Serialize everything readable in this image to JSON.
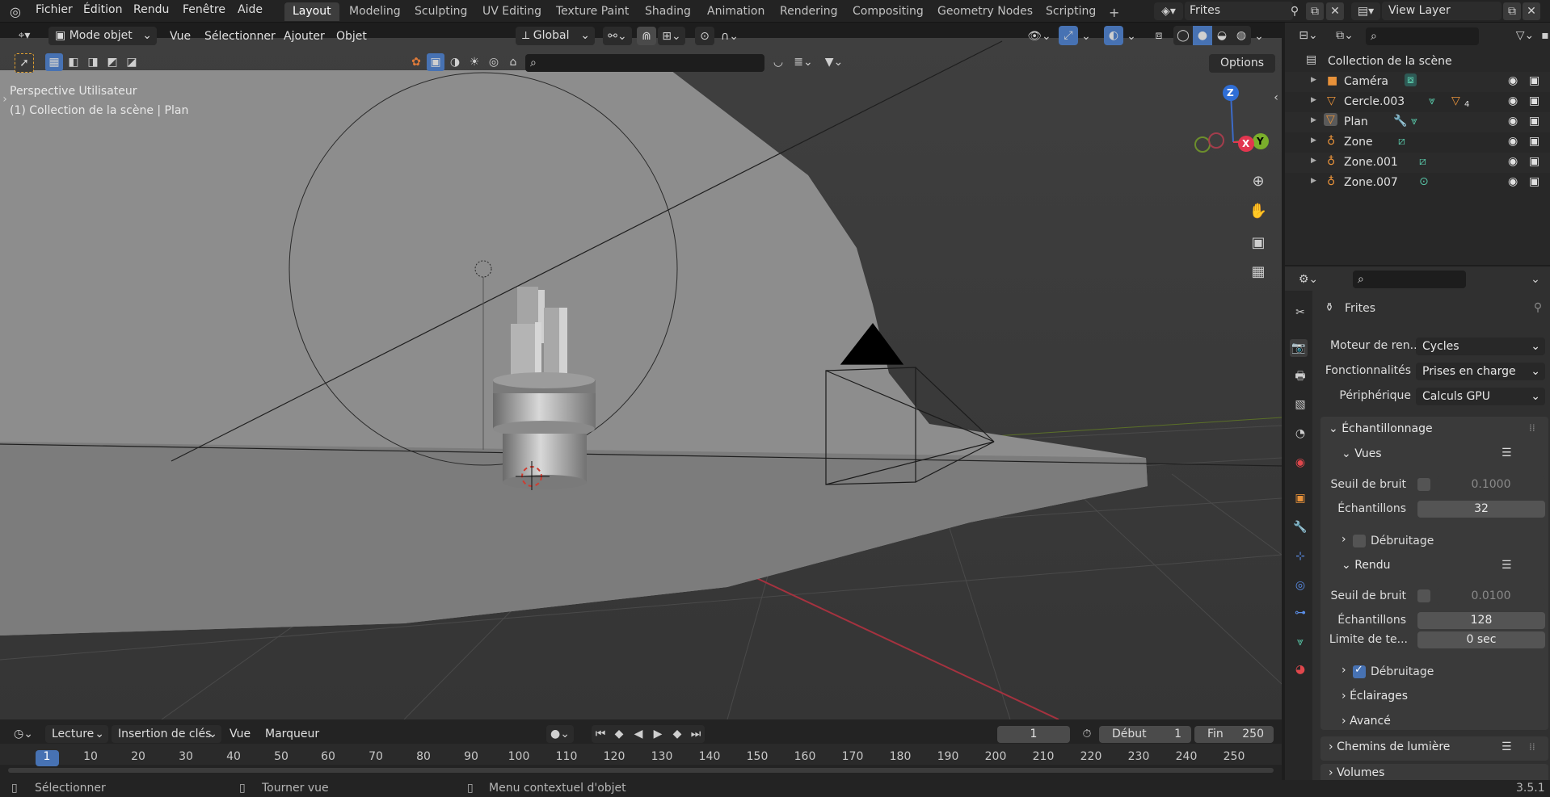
{
  "topbar": {
    "menu": [
      "Fichier",
      "Édition",
      "Rendu",
      "Fenêtre",
      "Aide"
    ],
    "workspaces": [
      "Layout",
      "Modeling",
      "Sculpting",
      "UV Editing",
      "Texture Paint",
      "Shading",
      "Animation",
      "Rendering",
      "Compositing",
      "Geometry Nodes",
      "Scripting"
    ],
    "active_workspace": "Layout",
    "add_tab": "+",
    "scene_name": "Frites",
    "view_layer": "View Layer"
  },
  "viewport_header": {
    "mode": "Mode objet",
    "menus": [
      "Vue",
      "Sélectionner",
      "Ajouter",
      "Objet"
    ],
    "orientation": "Global",
    "options": "Options"
  },
  "viewport": {
    "view_name": "Perspective Utilisateur",
    "context": "(1) Collection de la scène | Plan",
    "gizmo": {
      "z": "Z",
      "y": "Y",
      "x": "X"
    }
  },
  "outliner": {
    "root": "Collection de la scène",
    "items": [
      {
        "name": "Caméra",
        "icon": "camera-icon",
        "color": "#e8923a"
      },
      {
        "name": "Cercle.003",
        "icon": "mesh-icon",
        "color": "#e8923a",
        "badge": "4"
      },
      {
        "name": "Plan",
        "icon": "mesh-icon",
        "color": "#e8923a"
      },
      {
        "name": "Zone",
        "icon": "light-icon",
        "color": "#e8923a"
      },
      {
        "name": "Zone.001",
        "icon": "light-icon",
        "color": "#e8923a"
      },
      {
        "name": "Zone.007",
        "icon": "light-icon",
        "color": "#e8923a"
      }
    ]
  },
  "properties": {
    "scene": "Frites",
    "render_engine_label": "Moteur de ren...",
    "render_engine": "Cycles",
    "features_label": "Fonctionnalités",
    "features": "Prises en charge",
    "device_label": "Périphérique",
    "device": "Calculs GPU",
    "sampling": "Échantillonnage",
    "viewport_section": "Vues",
    "noise_threshold_label": "Seuil de bruit",
    "vp_noise_threshold": "0.1000",
    "samples_label": "Échantillons",
    "vp_samples": "32",
    "denoise_label": "Débruitage",
    "render_section": "Rendu",
    "r_noise_threshold": "0.0100",
    "r_samples": "128",
    "time_limit_label": "Limite de te...",
    "time_limit": "0 sec",
    "lights": "Éclairages",
    "advanced": "Avancé",
    "light_paths": "Chemins de lumière",
    "volumes": "Volumes"
  },
  "timeline": {
    "menus": [
      "Lecture",
      "Insertion de clés",
      "Vue",
      "Marqueur"
    ],
    "current_frame": "1",
    "start_label": "Début",
    "start": "1",
    "end_label": "Fin",
    "end": "250",
    "ruler": [
      "1",
      "10",
      "20",
      "30",
      "40",
      "50",
      "60",
      "70",
      "80",
      "90",
      "100",
      "110",
      "120",
      "130",
      "140",
      "150",
      "160",
      "170",
      "180",
      "190",
      "200",
      "210",
      "220",
      "230",
      "240",
      "250"
    ]
  },
  "statusbar": {
    "select": "Sélectionner",
    "rotate": "Tourner vue",
    "context_menu": "Menu contextuel d'objet",
    "version": "3.5.1"
  },
  "colors": {
    "accent": "#4772b3",
    "active_frame": "#4772b3",
    "x_axis": "#e2364f",
    "y_axis": "#7aae2b",
    "z_axis": "#2f6ed6"
  }
}
